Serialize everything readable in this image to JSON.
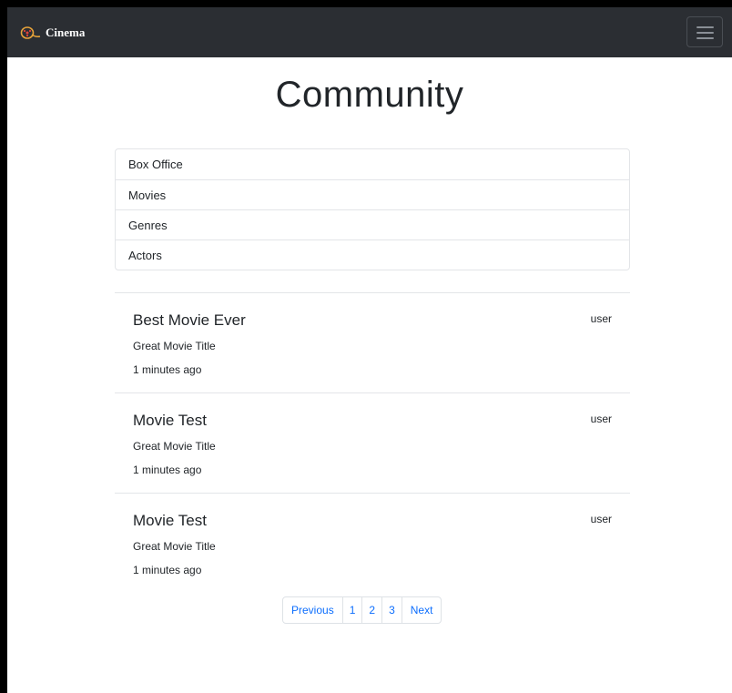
{
  "navbar": {
    "brand_name": "Cinema",
    "brand_logo_icon": "film-reel-logo-icon",
    "menu_toggle_icon": "hamburger-menu-icon",
    "background_color": "#2b2e33"
  },
  "page": {
    "title": "Community"
  },
  "sidebar": {
    "items": [
      {
        "label": "Box Office"
      },
      {
        "label": "Movies"
      },
      {
        "label": "Genres"
      },
      {
        "label": "Actors"
      }
    ]
  },
  "posts": [
    {
      "title": "Best Movie Ever",
      "author": "user",
      "movie": "Great Movie Title",
      "time": "1 minutes ago"
    },
    {
      "title": "Movie Test",
      "author": "user",
      "movie": "Great Movie Title",
      "time": "1 minutes ago"
    },
    {
      "title": "Movie Test",
      "author": "user",
      "movie": "Great Movie Title",
      "time": "1 minutes ago"
    }
  ],
  "pagination": {
    "previous_label": "Previous",
    "pages": [
      "1",
      "2",
      "3"
    ],
    "next_label": "Next",
    "link_color": "#0d6efd"
  }
}
